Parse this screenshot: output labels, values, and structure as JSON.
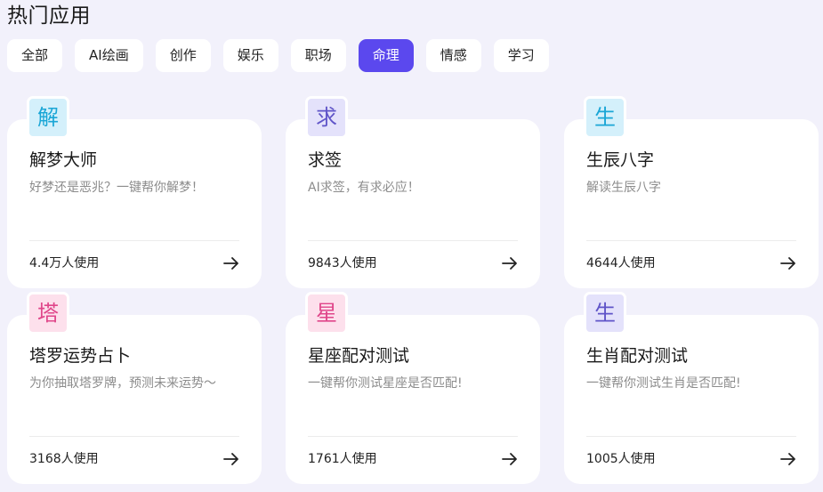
{
  "header": {
    "title": "热门应用"
  },
  "tabs": [
    {
      "label": "全部",
      "active": false
    },
    {
      "label": "AI绘画",
      "active": false
    },
    {
      "label": "创作",
      "active": false
    },
    {
      "label": "娱乐",
      "active": false
    },
    {
      "label": "职场",
      "active": false
    },
    {
      "label": "命理",
      "active": true
    },
    {
      "label": "情感",
      "active": false
    },
    {
      "label": "学习",
      "active": false
    }
  ],
  "cards": [
    {
      "badge": "解",
      "title": "解梦大师",
      "desc": "好梦还是恶兆？一键帮你解梦！",
      "usage": "4.4万人使用",
      "badge_bg": "#d4f0fb",
      "badge_fg": "#1aa6d6"
    },
    {
      "badge": "求",
      "title": "求签",
      "desc": "AI求签，有求必应！",
      "usage": "9843人使用",
      "badge_bg": "#e4e2fb",
      "badge_fg": "#5f54c8"
    },
    {
      "badge": "生",
      "title": "生辰八字",
      "desc": "解读生辰八字",
      "usage": "4644人使用",
      "badge_bg": "#d4f0fb",
      "badge_fg": "#1aa6d6"
    },
    {
      "badge": "塔",
      "title": "塔罗运势占卜",
      "desc": "为你抽取塔罗牌，预测未来运势～",
      "usage": "3168人使用",
      "badge_bg": "#fde0ec",
      "badge_fg": "#e0468a"
    },
    {
      "badge": "星",
      "title": "星座配对测试",
      "desc": "一键帮你测试星座是否匹配!",
      "usage": "1761人使用",
      "badge_bg": "#fde0ec",
      "badge_fg": "#e0468a"
    },
    {
      "badge": "生",
      "title": "生肖配对测试",
      "desc": "一键帮你测试生肖是否匹配!",
      "usage": "1005人使用",
      "badge_bg": "#e4e2fb",
      "badge_fg": "#5f54c8"
    }
  ],
  "icons": {
    "arrow": "arrow-right-icon"
  }
}
